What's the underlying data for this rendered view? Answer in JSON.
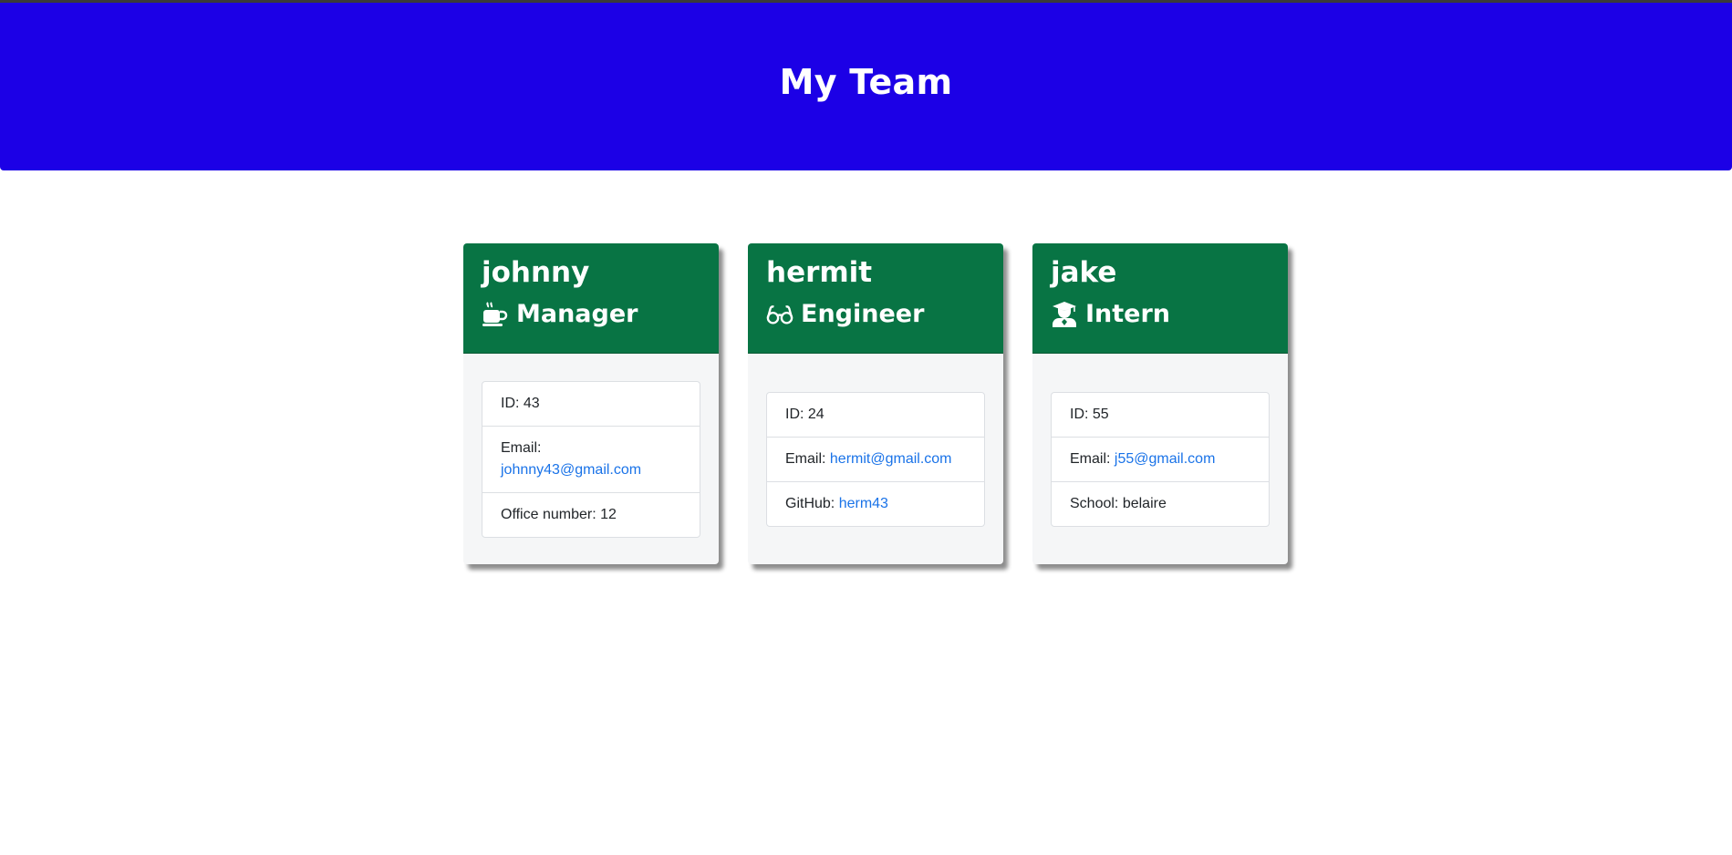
{
  "header": {
    "title": "My Team"
  },
  "colors": {
    "header_bg": "#1c00e6",
    "card_header_bg": "#087444",
    "link": "#1a73e8"
  },
  "employees": [
    {
      "name": "johnny",
      "role": "Manager",
      "icon": "coffee-mug-icon",
      "id_label": "ID: ",
      "id": "43",
      "email_label": "Email: ",
      "email": "johnny43@gmail.com",
      "extra_label": "Office number: ",
      "extra_value": "12"
    },
    {
      "name": "hermit",
      "role": "Engineer",
      "icon": "glasses-icon",
      "id_label": "ID: ",
      "id": "24",
      "email_label": "Email: ",
      "email": "hermit@gmail.com",
      "extra_label": "GitHub: ",
      "extra_value": "herm43"
    },
    {
      "name": "jake",
      "role": "Intern",
      "icon": "graduate-icon",
      "id_label": "ID: ",
      "id": "55",
      "email_label": "Email: ",
      "email": "j55@gmail.com",
      "extra_label": "School: ",
      "extra_value": "belaire"
    }
  ]
}
